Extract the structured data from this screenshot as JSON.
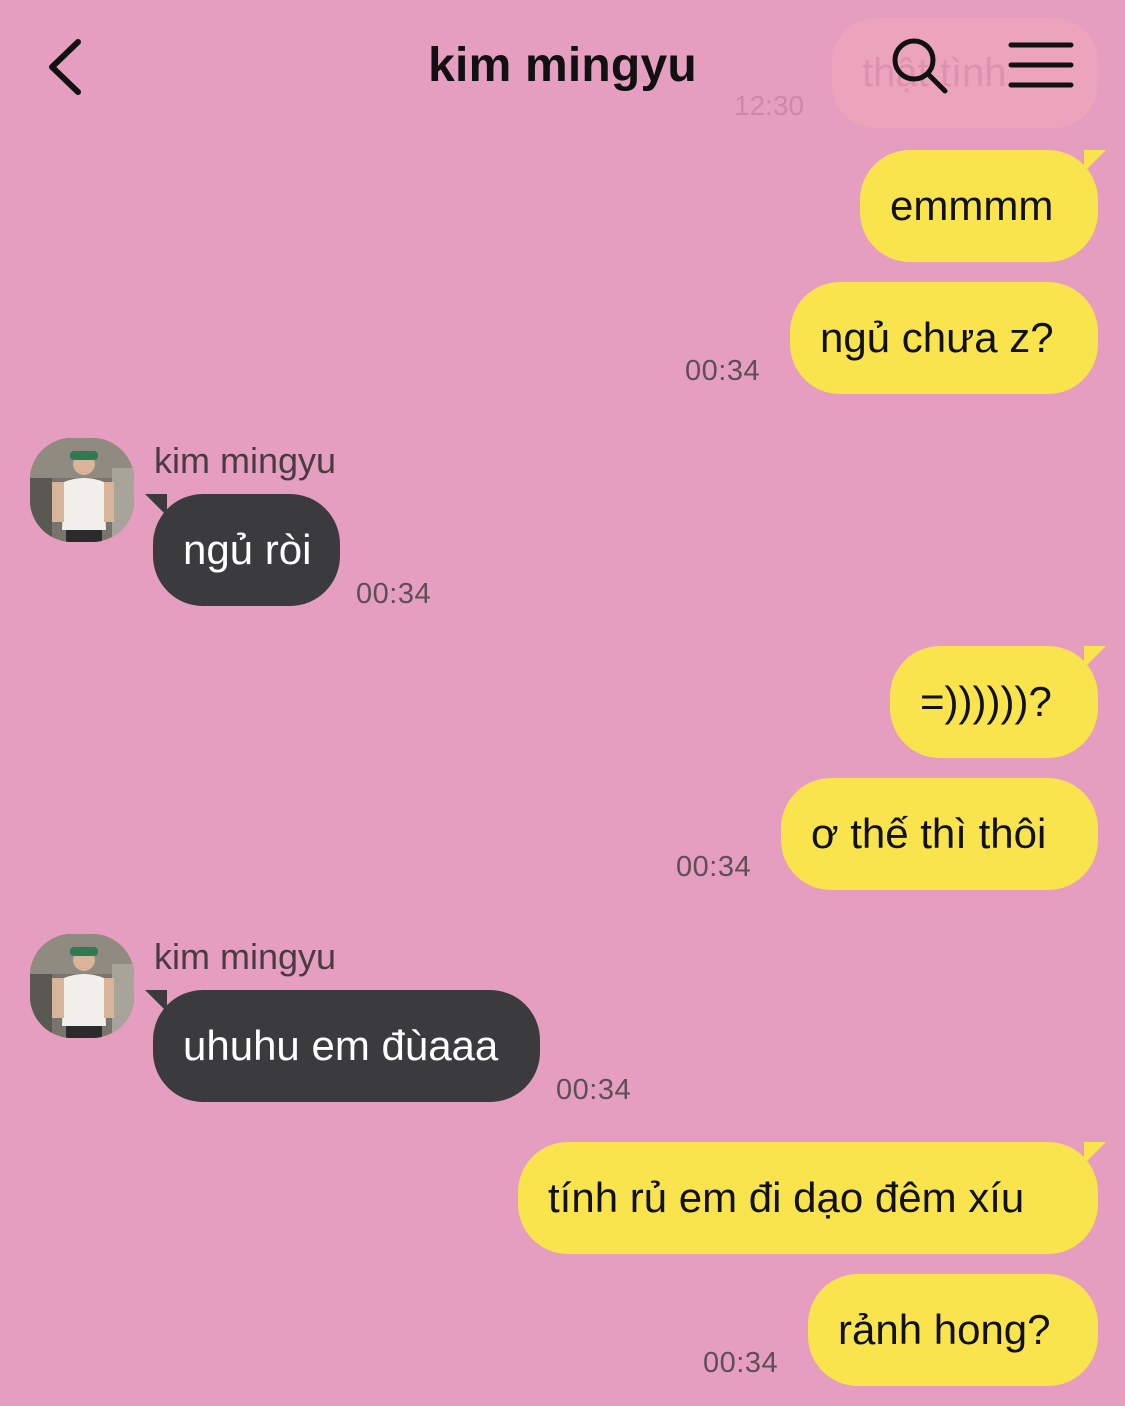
{
  "header": {
    "title": "kim mingyu",
    "back_icon": "chevron-left-icon",
    "search_icon": "search-icon",
    "menu_icon": "hamburger-menu-icon"
  },
  "ghost_message": {
    "text": "thật tình",
    "time": "12:30"
  },
  "contact": {
    "name": "kim mingyu"
  },
  "messages": [
    {
      "from": "me",
      "text": "emmmm"
    },
    {
      "from": "me",
      "text": "ngủ chưa z?",
      "time": "00:34"
    },
    {
      "from": "them",
      "sender": "kim mingyu",
      "text": "ngủ ròi",
      "time": "00:34"
    },
    {
      "from": "me",
      "text": "=))))))?"
    },
    {
      "from": "me",
      "text": "ơ thế thì thôi",
      "time": "00:34"
    },
    {
      "from": "them",
      "sender": "kim mingyu",
      "text": "uhuhu em đùaaa",
      "time": "00:34"
    },
    {
      "from": "me",
      "text": "tính rủ em đi dạo đêm xíu"
    },
    {
      "from": "me",
      "text": "rảnh hong?",
      "time": "00:34"
    }
  ],
  "colors": {
    "background": "#E59EBF",
    "my_bubble": "#F9E44E",
    "their_bubble": "#3B3B3D"
  }
}
